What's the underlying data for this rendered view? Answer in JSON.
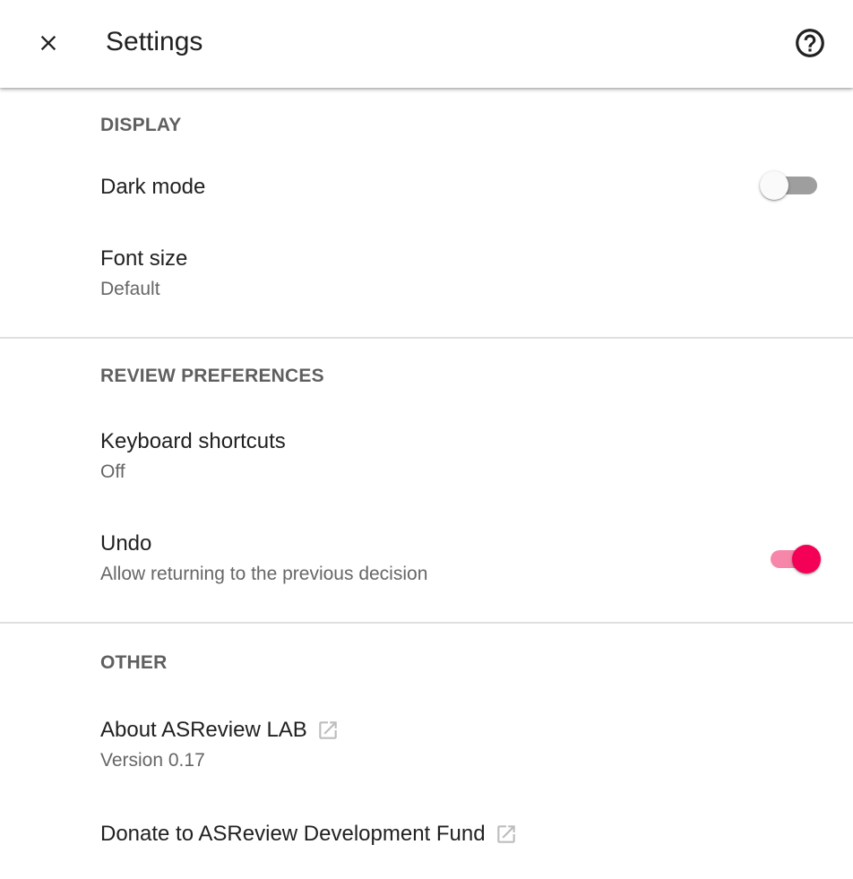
{
  "header": {
    "title": "Settings",
    "close_icon": "close-icon",
    "help_icon": "help-circle-icon"
  },
  "sections": {
    "display": {
      "title": "DISPLAY",
      "dark_mode": {
        "label": "Dark mode",
        "enabled": false
      },
      "font_size": {
        "label": "Font size",
        "value": "Default"
      }
    },
    "review": {
      "title": "REVIEW PREFERENCES",
      "keyboard_shortcuts": {
        "label": "Keyboard shortcuts",
        "value": "Off"
      },
      "undo": {
        "label": "Undo",
        "description": "Allow returning to the previous decision",
        "enabled": true
      }
    },
    "other": {
      "title": "OTHER",
      "about": {
        "label": "About ASReview LAB",
        "version": "Version 0.17",
        "icon": "open-in-new-icon"
      },
      "donate": {
        "label": "Donate to ASReview Development Fund",
        "icon": "open-in-new-icon"
      }
    }
  },
  "colors": {
    "accent": "#f50057",
    "accent_track": "#f687aa",
    "toggle_off_track": "#9e9e9e",
    "divider": "#e0e0e0",
    "section_title": "#5f5f5f",
    "secondary_text": "#666666"
  }
}
